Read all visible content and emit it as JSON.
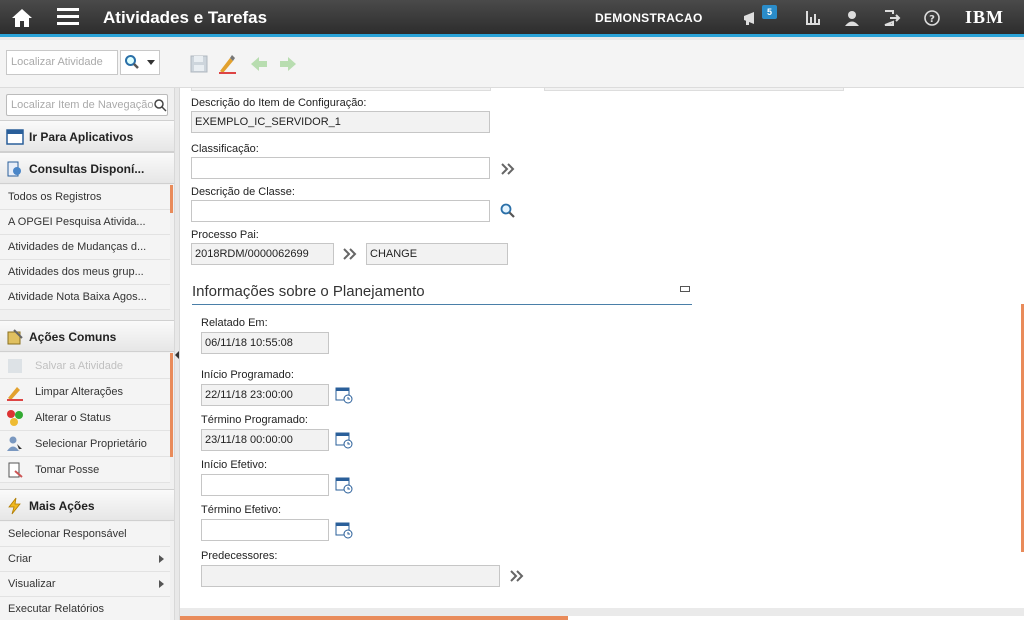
{
  "header": {
    "title": "Atividades e Tarefas",
    "site": "DEMONSTRACAO",
    "notification_count": "5",
    "brand": "IBM"
  },
  "toolbar": {
    "search_placeholder": "Localizar Atividade"
  },
  "leftnav": {
    "search_placeholder": "Localizar Item de Navegação",
    "goto_apps": "Ir Para Aplicativos",
    "queries_header": "Consultas Disponí...",
    "queries": [
      "Todos os Registros",
      "A OPGEI Pesquisa Ativida...",
      "Atividades de Mudanças d...",
      "Atividades dos meus grup...",
      "Atividade Nota Baixa Agos..."
    ],
    "common_header": "Ações Comuns",
    "common_actions": [
      {
        "label": "Salvar a Atividade",
        "disabled": true
      },
      {
        "label": "Limpar Alterações",
        "disabled": false
      },
      {
        "label": "Alterar o Status",
        "disabled": false
      },
      {
        "label": "Selecionar Proprietário",
        "disabled": false
      },
      {
        "label": "Tomar Posse",
        "disabled": false
      }
    ],
    "more_header": "Mais Ações",
    "more_actions": [
      {
        "label": "Selecionar Responsável",
        "submenu": false
      },
      {
        "label": "Criar",
        "submenu": true
      },
      {
        "label": "Visualizar",
        "submenu": true
      },
      {
        "label": "Executar Relatórios",
        "submenu": false
      }
    ]
  },
  "form": {
    "ci_desc_label": "Descrição do Item de Configuração:",
    "ci_desc_value": "EXEMPLO_IC_SERVIDOR_1",
    "classification_label": "Classificação:",
    "classification_value": "",
    "class_desc_label": "Descrição de Classe:",
    "class_desc_value": "",
    "parent_label": "Processo Pai:",
    "parent_value": "2018RDM/0000062699",
    "parent_class": "CHANGE"
  },
  "planning": {
    "title": "Informações sobre o Planejamento",
    "reported_label": "Relatado Em:",
    "reported_value": "06/11/18 10:55:08",
    "sched_start_label": "Início Programado:",
    "sched_start_value": "22/11/18 23:00:00",
    "sched_finish_label": "Término Programado:",
    "sched_finish_value": "23/11/18 00:00:00",
    "actual_start_label": "Início Efetivo:",
    "actual_start_value": "",
    "actual_finish_label": "Término Efetivo:",
    "actual_finish_value": "",
    "predecessors_label": "Predecessores:",
    "predecessors_value": ""
  },
  "colors": {
    "accent": "#2aa3d8",
    "scroll": "#e98b5a"
  }
}
